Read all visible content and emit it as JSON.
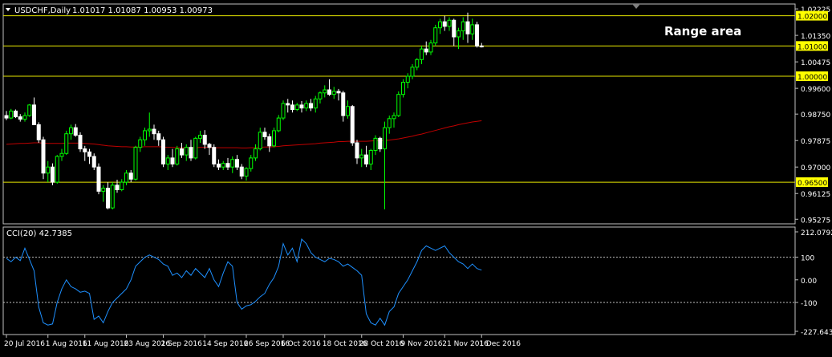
{
  "header": {
    "symbol_tf": "USDCHF,Daily",
    "ohlc": "1.01017 1.01087 1.00953 1.00973"
  },
  "annotation": "Range area",
  "colors": {
    "background": "#000000",
    "grid_frame": "#c0c0c0",
    "bull_candle": "#00ff00",
    "bull_body": "#000000",
    "bear_candle": "#ffffff",
    "ma_line": "#c00000",
    "level_line": "#e6e600",
    "level_label_bg": "#ffff00",
    "cci_line": "#1e90ff",
    "text": "#ffffff"
  },
  "chart_data": [
    {
      "type": "candlestick",
      "title": "USDCHF,Daily",
      "price_axis_labels": [
        "1.02225",
        "1.01350",
        "1.00475",
        "0.99600",
        "0.98750",
        "0.97875",
        "0.97000",
        "0.96125",
        "0.95275"
      ],
      "ylim": [
        0.9515,
        1.0236
      ],
      "horizontal_levels": [
        {
          "label": "1.02000",
          "value": 1.02
        },
        {
          "label": "1.01000",
          "value": 1.01
        },
        {
          "label": "1.00000",
          "value": 1.0
        },
        {
          "label": "0.96500",
          "value": 0.965
        }
      ],
      "x_tick_labels": [
        "20 Jul 2016",
        "1 Aug 2016",
        "11 Aug 2016",
        "23 Aug 2016",
        "2 Sep 2016",
        "14 Sep 2016",
        "26 Sep 2016",
        "6 Oct 2016",
        "18 Oct 2016",
        "28 Oct 2016",
        "9 Nov 2016",
        "21 Nov 2016",
        "1 Dec 2016"
      ],
      "x_tick_index": [
        0,
        9,
        17,
        26,
        34,
        43,
        52,
        60,
        69,
        77,
        86,
        95,
        103
      ],
      "candles": [
        [
          0.987,
          0.9885,
          0.9855,
          0.9862
        ],
        [
          0.9862,
          0.9892,
          0.9858,
          0.9885
        ],
        [
          0.9885,
          0.989,
          0.9862,
          0.9866
        ],
        [
          0.9866,
          0.9875,
          0.985,
          0.9858
        ],
        [
          0.9858,
          0.988,
          0.985,
          0.987
        ],
        [
          0.987,
          0.9908,
          0.9866,
          0.9905
        ],
        [
          0.9905,
          0.993,
          0.988,
          0.984
        ],
        [
          0.984,
          0.9848,
          0.978,
          0.979
        ],
        [
          0.979,
          0.98,
          0.966,
          0.968
        ],
        [
          0.968,
          0.972,
          0.965,
          0.97
        ],
        [
          0.97,
          0.9712,
          0.964,
          0.965
        ],
        [
          0.965,
          0.974,
          0.9645,
          0.9735
        ],
        [
          0.9735,
          0.976,
          0.972,
          0.9745
        ],
        [
          0.9745,
          0.982,
          0.974,
          0.981
        ],
        [
          0.981,
          0.984,
          0.979,
          0.983
        ],
        [
          0.983,
          0.9842,
          0.98,
          0.9805
        ],
        [
          0.9805,
          0.9815,
          0.975,
          0.976
        ],
        [
          0.976,
          0.977,
          0.972,
          0.975
        ],
        [
          0.975,
          0.976,
          0.971,
          0.9735
        ],
        [
          0.9735,
          0.9745,
          0.969,
          0.97
        ],
        [
          0.97,
          0.9712,
          0.961,
          0.962
        ],
        [
          0.962,
          0.964,
          0.9585,
          0.963
        ],
        [
          0.963,
          0.965,
          0.956,
          0.9565
        ],
        [
          0.9565,
          0.965,
          0.956,
          0.964
        ],
        [
          0.964,
          0.9658,
          0.9615,
          0.9625
        ],
        [
          0.9625,
          0.966,
          0.962,
          0.965
        ],
        [
          0.965,
          0.969,
          0.964,
          0.968
        ],
        [
          0.968,
          0.969,
          0.965,
          0.966
        ],
        [
          0.966,
          0.977,
          0.9655,
          0.9765
        ],
        [
          0.9765,
          0.98,
          0.975,
          0.979
        ],
        [
          0.979,
          0.983,
          0.977,
          0.982
        ],
        [
          0.982,
          0.988,
          0.98,
          0.9825
        ],
        [
          0.9825,
          0.984,
          0.979,
          0.981
        ],
        [
          0.981,
          0.982,
          0.977,
          0.979
        ],
        [
          0.979,
          0.98,
          0.97,
          0.971
        ],
        [
          0.971,
          0.974,
          0.969,
          0.973
        ],
        [
          0.973,
          0.976,
          0.97,
          0.971
        ],
        [
          0.971,
          0.977,
          0.9705,
          0.976
        ],
        [
          0.976,
          0.978,
          0.973,
          0.974
        ],
        [
          0.974,
          0.9775,
          0.972,
          0.9765
        ],
        [
          0.9765,
          0.979,
          0.972,
          0.973
        ],
        [
          0.973,
          0.98,
          0.9725,
          0.9795
        ],
        [
          0.9795,
          0.982,
          0.978,
          0.9805
        ],
        [
          0.9805,
          0.9822,
          0.976,
          0.9775
        ],
        [
          0.9775,
          0.978,
          0.974,
          0.9765
        ],
        [
          0.9765,
          0.9775,
          0.97,
          0.971
        ],
        [
          0.971,
          0.9725,
          0.969,
          0.97
        ],
        [
          0.97,
          0.972,
          0.969,
          0.9712
        ],
        [
          0.9712,
          0.973,
          0.969,
          0.97
        ],
        [
          0.97,
          0.9735,
          0.968,
          0.9725
        ],
        [
          0.9725,
          0.974,
          0.969,
          0.97
        ],
        [
          0.97,
          0.971,
          0.966,
          0.967
        ],
        [
          0.967,
          0.97,
          0.9655,
          0.9695
        ],
        [
          0.9695,
          0.974,
          0.9685,
          0.973
        ],
        [
          0.973,
          0.9775,
          0.972,
          0.976
        ],
        [
          0.976,
          0.983,
          0.9755,
          0.9815
        ],
        [
          0.9815,
          0.983,
          0.979,
          0.98
        ],
        [
          0.98,
          0.981,
          0.975,
          0.977
        ],
        [
          0.977,
          0.983,
          0.9765,
          0.982
        ],
        [
          0.982,
          0.9872,
          0.9815,
          0.9862
        ],
        [
          0.9862,
          0.992,
          0.9855,
          0.991
        ],
        [
          0.991,
          0.9925,
          0.988,
          0.9905
        ],
        [
          0.9905,
          0.992,
          0.988,
          0.989
        ],
        [
          0.989,
          0.9912,
          0.9885,
          0.9905
        ],
        [
          0.9905,
          0.9918,
          0.988,
          0.9895
        ],
        [
          0.9895,
          0.992,
          0.9885,
          0.991
        ],
        [
          0.991,
          0.9925,
          0.9885,
          0.9895
        ],
        [
          0.9895,
          0.9935,
          0.988,
          0.9925
        ],
        [
          0.9925,
          0.995,
          0.991,
          0.9945
        ],
        [
          0.9945,
          0.997,
          0.993,
          0.9955
        ],
        [
          0.9955,
          0.999,
          0.9935,
          0.994
        ],
        [
          0.994,
          0.9965,
          0.9925,
          0.995
        ],
        [
          0.995,
          0.9958,
          0.992,
          0.9945
        ],
        [
          0.9945,
          0.9952,
          0.985,
          0.987
        ],
        [
          0.987,
          0.992,
          0.986,
          0.99
        ],
        [
          0.99,
          0.9905,
          0.977,
          0.978
        ],
        [
          0.978,
          0.979,
          0.971,
          0.973
        ],
        [
          0.973,
          0.976,
          0.97,
          0.974
        ],
        [
          0.974,
          0.977,
          0.97,
          0.971
        ],
        [
          0.971,
          0.976,
          0.969,
          0.9755
        ],
        [
          0.9755,
          0.9805,
          0.974,
          0.9795
        ],
        [
          0.9795,
          0.98,
          0.975,
          0.976
        ],
        [
          0.976,
          0.985,
          0.956,
          0.983
        ],
        [
          0.983,
          0.987,
          0.981,
          0.986
        ],
        [
          0.986,
          0.988,
          0.983,
          0.987
        ],
        [
          0.987,
          0.995,
          0.9865,
          0.994
        ],
        [
          0.994,
          0.999,
          0.993,
          0.998
        ],
        [
          0.998,
          1.001,
          0.996,
          1.0
        ],
        [
          1.0,
          1.004,
          0.999,
          1.003
        ],
        [
          1.003,
          1.006,
          1.002,
          1.0055
        ],
        [
          1.0055,
          1.01,
          1.004,
          1.009
        ],
        [
          1.009,
          1.0115,
          1.007,
          1.008
        ],
        [
          1.008,
          1.012,
          1.007,
          1.011
        ],
        [
          1.011,
          1.017,
          1.01,
          1.016
        ],
        [
          1.016,
          1.019,
          1.014,
          1.018
        ],
        [
          1.018,
          1.02,
          1.015,
          1.0165
        ],
        [
          1.0165,
          1.0195,
          1.015,
          1.0185
        ],
        [
          1.0185,
          1.019,
          1.01,
          1.013
        ],
        [
          1.013,
          1.016,
          1.009,
          1.015
        ],
        [
          1.015,
          1.0195,
          1.012,
          1.018
        ],
        [
          1.018,
          1.021,
          1.011,
          1.014
        ],
        [
          1.014,
          1.019,
          1.012,
          1.017
        ],
        [
          1.017,
          1.018,
          1.0095,
          1.01
        ],
        [
          1.01,
          1.011,
          1.0095,
          1.0097
        ]
      ],
      "moving_average": [
        0.9775,
        0.9776,
        0.9777,
        0.9778,
        0.9778,
        0.9779,
        0.978,
        0.978,
        0.9779,
        0.9778,
        0.9778,
        0.9778,
        0.9778,
        0.9779,
        0.9779,
        0.9779,
        0.9779,
        0.9778,
        0.9777,
        0.9776,
        0.9774,
        0.9772,
        0.977,
        0.9769,
        0.9768,
        0.9767,
        0.9767,
        0.9766,
        0.9766,
        0.9766,
        0.9767,
        0.9767,
        0.9767,
        0.9767,
        0.9766,
        0.9765,
        0.9765,
        0.9764,
        0.9764,
        0.9764,
        0.9764,
        0.9764,
        0.9765,
        0.9765,
        0.9765,
        0.9764,
        0.9764,
        0.9764,
        0.9764,
        0.9764,
        0.9764,
        0.9763,
        0.9763,
        0.9764,
        0.9764,
        0.9765,
        0.9766,
        0.9766,
        0.9767,
        0.9768,
        0.977,
        0.9771,
        0.9772,
        0.9773,
        0.9774,
        0.9775,
        0.9776,
        0.9777,
        0.9779,
        0.978,
        0.9781,
        0.9782,
        0.9784,
        0.9784,
        0.9785,
        0.9785,
        0.9785,
        0.9785,
        0.9785,
        0.9786,
        0.9787,
        0.9787,
        0.9788,
        0.9789,
        0.9791,
        0.9793,
        0.9796,
        0.9799,
        0.9802,
        0.9806,
        0.9809,
        0.9813,
        0.9817,
        0.9821,
        0.9825,
        0.9829,
        0.9833,
        0.9836,
        0.984,
        0.9843,
        0.9846,
        0.9849,
        0.9851,
        0.9853
      ]
    },
    {
      "type": "line",
      "title": "CCI(20) 42.7385",
      "axis_labels": [
        "212.0792",
        "100",
        "0.00",
        "-100",
        "-227.6436"
      ],
      "ylim": [
        -227.6436,
        212.0792
      ],
      "reference_levels": [
        100,
        -100
      ],
      "series": [
        {
          "name": "CCI(20)",
          "values": [
            95,
            80,
            100,
            85,
            140,
            90,
            40,
            -120,
            -190,
            -200,
            -195,
            -100,
            -40,
            0,
            -30,
            -40,
            -55,
            -50,
            -60,
            -175,
            -160,
            -190,
            -140,
            -100,
            -80,
            -60,
            -40,
            0,
            60,
            80,
            100,
            110,
            100,
            90,
            70,
            60,
            20,
            30,
            10,
            40,
            20,
            50,
            30,
            10,
            50,
            0,
            -30,
            30,
            80,
            60,
            -100,
            -130,
            -115,
            -110,
            -95,
            -75,
            -60,
            -20,
            10,
            60,
            160,
            110,
            140,
            80,
            180,
            160,
            120,
            100,
            90,
            80,
            95,
            90,
            80,
            60,
            70,
            55,
            40,
            20,
            -150,
            -190,
            -200,
            -170,
            -200,
            -140,
            -120,
            -60,
            -30,
            0,
            40,
            80,
            130,
            150,
            140,
            130,
            140,
            150,
            120,
            100,
            80,
            70,
            50,
            70,
            50,
            43
          ]
        }
      ]
    }
  ]
}
